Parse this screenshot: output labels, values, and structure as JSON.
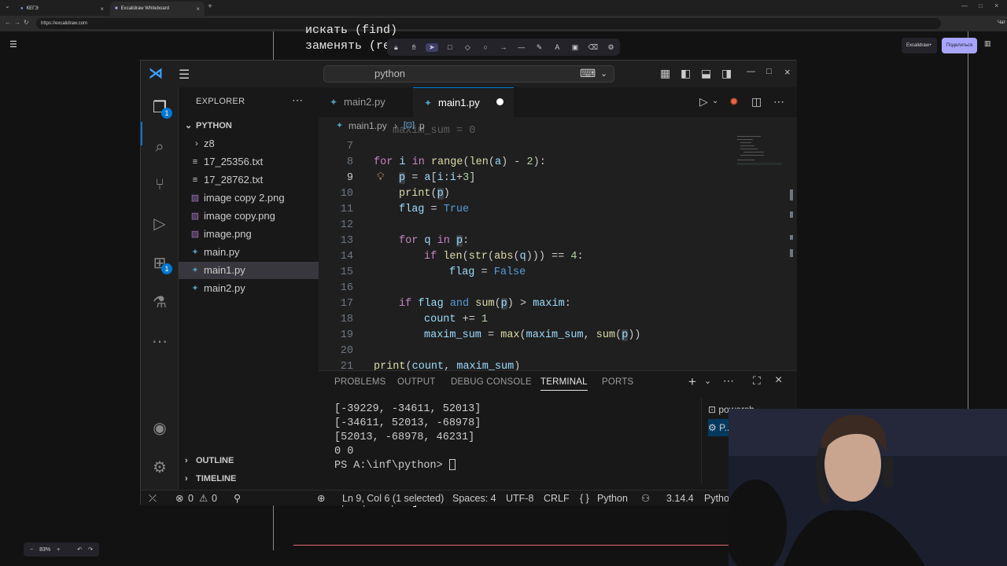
{
  "browser": {
    "tabs": [
      {
        "label": "КЕГЭ",
        "active": false
      },
      {
        "label": "Excalidraw Whiteboard",
        "active": true
      }
    ],
    "url": "https://excalidraw.com"
  },
  "excalidraw": {
    "board_lines": [
      "искать (find)",
      "заменять (re",
      "...",
      "# 21 , 2, 3 , 4]"
    ],
    "plus_button": "Excalidraw+",
    "share_button": "Поделиться",
    "zoom": "83%",
    "tab_suffix": "Чат"
  },
  "vscode": {
    "command_center": "python",
    "explorer_title": "EXPLORER",
    "source_control_badge": "1",
    "extensions_badge": "1",
    "folder": "PYTHON",
    "files": [
      {
        "name": "z8",
        "type": "folder"
      },
      {
        "name": "17_25356.txt",
        "type": "txt"
      },
      {
        "name": "17_28762.txt",
        "type": "txt"
      },
      {
        "name": "image copy 2.png",
        "type": "png"
      },
      {
        "name": "image copy.png",
        "type": "png"
      },
      {
        "name": "image.png",
        "type": "png"
      },
      {
        "name": "main.py",
        "type": "py"
      },
      {
        "name": "main1.py",
        "type": "py",
        "selected": true
      },
      {
        "name": "main2.py",
        "type": "py"
      }
    ],
    "outline": "OUTLINE",
    "timeline": "TIMELINE",
    "tabs": [
      {
        "label": "main2.py",
        "active": false
      },
      {
        "label": "main1.py",
        "active": true,
        "dirty": true
      }
    ],
    "breadcrumb": {
      "file": "main1.py",
      "symbol": "p"
    },
    "code_lines": [
      {
        "n": "7",
        "text": ""
      },
      {
        "n": "8",
        "text": "for i in range(len(a) - 2):"
      },
      {
        "n": "9",
        "text": "    p = a[i:i+3]"
      },
      {
        "n": "10",
        "text": "    print(p)"
      },
      {
        "n": "11",
        "text": "    flag = True"
      },
      {
        "n": "12",
        "text": ""
      },
      {
        "n": "13",
        "text": "    for q in p:"
      },
      {
        "n": "14",
        "text": "        if len(str(abs(q))) == 4:"
      },
      {
        "n": "15",
        "text": "            flag = False"
      },
      {
        "n": "16",
        "text": ""
      },
      {
        "n": "17",
        "text": "    if flag and sum(p) > maxim:"
      },
      {
        "n": "18",
        "text": "        count += 1"
      },
      {
        "n": "19",
        "text": "        maxim_sum = max(maxim_sum, sum(p))"
      },
      {
        "n": "20",
        "text": ""
      },
      {
        "n": "21",
        "text": "print(count, maxim_sum)"
      }
    ],
    "panel_tabs": [
      "PROBLEMS",
      "OUTPUT",
      "DEBUG CONSOLE",
      "TERMINAL",
      "PORTS"
    ],
    "active_panel_tab": "TERMINAL",
    "terminal_lines": [
      "[-39229, -34611, 52013]",
      "[-34611, 52013, -68978]",
      "[52013, -68978, 46231]",
      "0 0",
      "PS A:\\inf\\python> "
    ],
    "terminal_list": [
      "powersh...",
      "P..."
    ],
    "status": {
      "errors": "0",
      "warnings": "0",
      "position": "Ln 9, Col 6 (1 selected)",
      "spaces": "Spaces: 4",
      "encoding": "UTF-8",
      "eol": "CRLF",
      "language": "Python",
      "version": "3.14.4",
      "interpreter": "Pytho"
    }
  }
}
